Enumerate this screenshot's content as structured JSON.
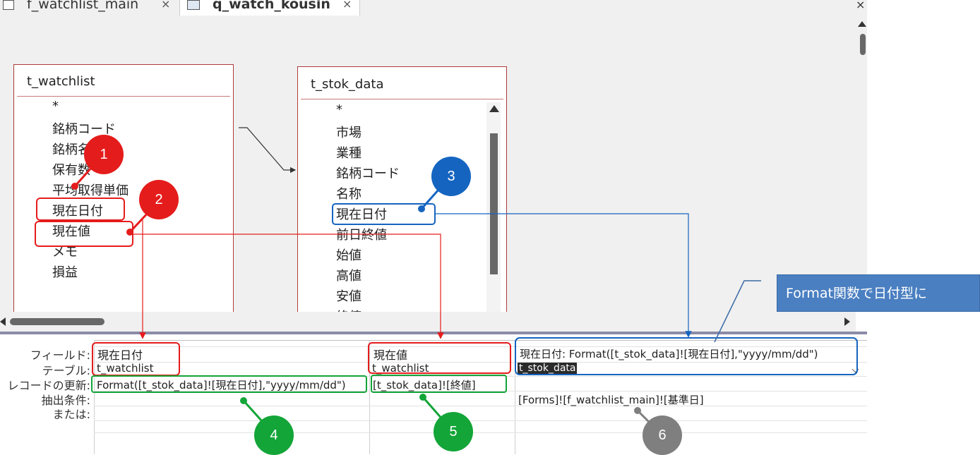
{
  "tabs": [
    {
      "label": "f_watchlist_main",
      "icon": "form-icon"
    },
    {
      "label": "q_watch_kousin",
      "icon": "query-icon"
    }
  ],
  "close_glyph": "×",
  "tables": [
    {
      "name": "t_watchlist",
      "fields": [
        "*",
        "銘柄コード",
        "銘柄名",
        "保有数",
        "平均取得単価",
        "現在日付",
        "現在値",
        "メモ",
        "損益"
      ]
    },
    {
      "name": "t_stok_data",
      "fields": [
        "*",
        "市場",
        "業種",
        "銘柄コード",
        "名称",
        "現在日付",
        "前日終値",
        "始値",
        "高値",
        "安値",
        "終値"
      ]
    }
  ],
  "grid": {
    "row_labels": [
      "フィールド:",
      "テーブル:",
      "レコードの更新:",
      "抽出条件:",
      "または:"
    ],
    "columns": [
      {
        "field": "現在日付",
        "table": "t_watchlist",
        "update": "Format([t_stok_data]![現在日付],\"yyyy/mm/dd\")",
        "criteria": ""
      },
      {
        "field": "現在値",
        "table": "t_watchlist",
        "update": "[t_stok_data]![終値]",
        "criteria": ""
      },
      {
        "field": "現在日付: Format([t_stok_data]![現在日付],\"yyyy/mm/dd\")",
        "table": "t_stok_data",
        "update": "",
        "criteria": "[Forms]![f_watchlist_main]![基準日]"
      }
    ]
  },
  "badges": [
    "1",
    "2",
    "3",
    "4",
    "5",
    "6"
  ],
  "note": "Format関数で日付型に",
  "colors": {
    "red": "#e51c1c",
    "blue": "#1565c0",
    "green": "#13a538",
    "gray": "#7f7f7f",
    "note_bg": "#4a7fc1"
  }
}
